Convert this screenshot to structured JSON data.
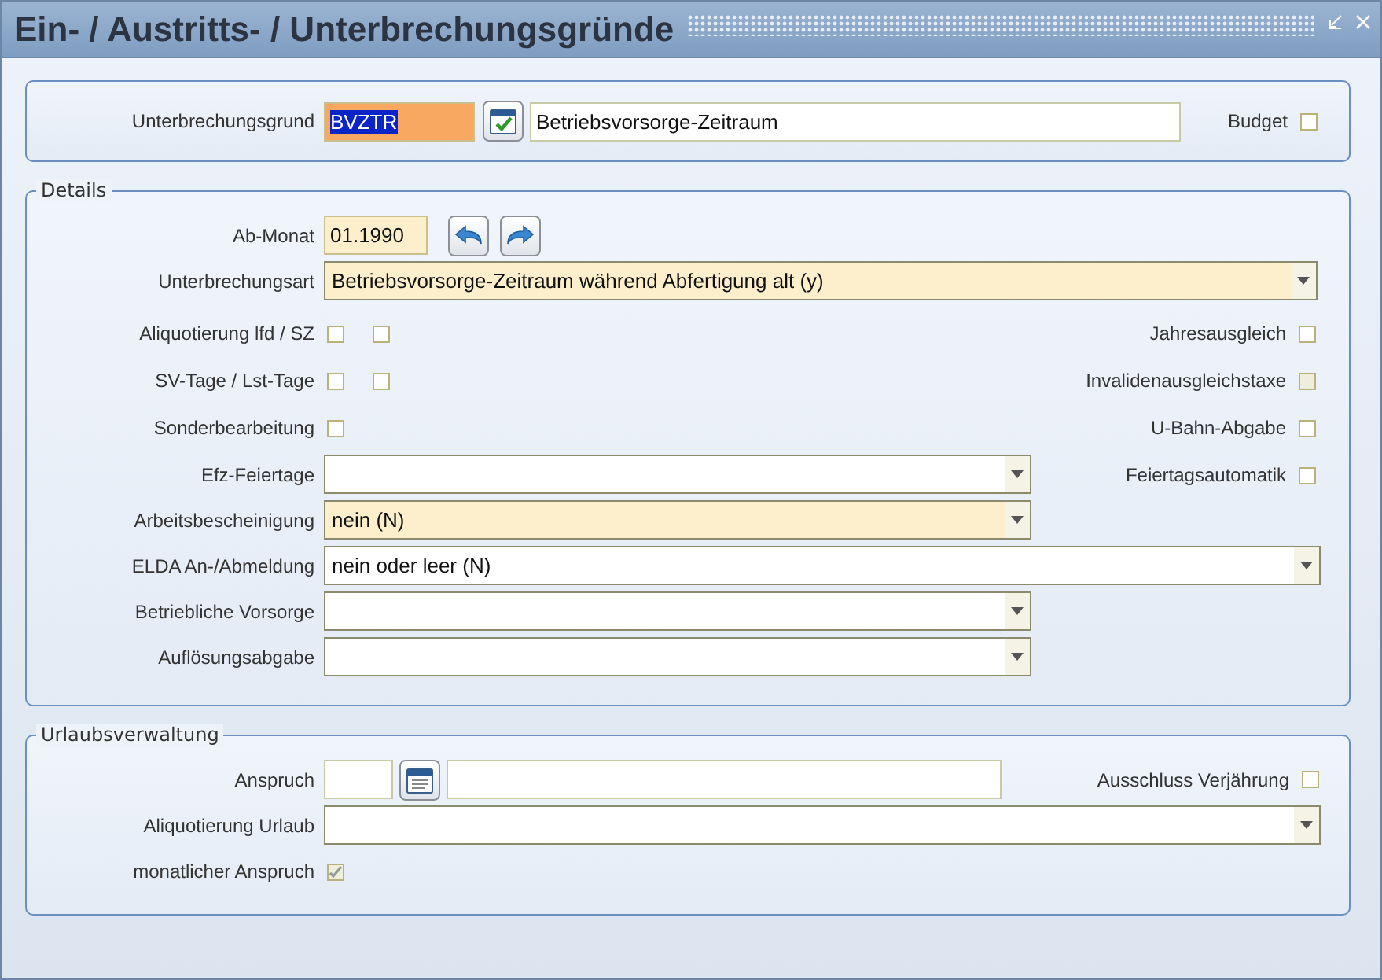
{
  "window": {
    "title": "Ein- / Austritts- / Unterbrechungsgründe"
  },
  "header": {
    "label": "Unterbrechungsgrund",
    "code": "BVZTR",
    "code_selected": true,
    "description": "Betriebsvorsorge-Zeitraum",
    "budget": {
      "label": "Budget",
      "checked": false
    }
  },
  "details": {
    "title": "Details",
    "ab_monat": {
      "label": "Ab-Monat",
      "value": "01.1990",
      "highlighted": true
    },
    "unterbrechungsart": {
      "label": "Unterbrechungsart",
      "value": "Betriebsvorsorge-Zeitraum während Abfertigung alt (y)",
      "highlighted": true
    },
    "left_checks": [
      {
        "label": "Aliquotierung lfd / SZ",
        "boxes": [
          {
            "checked": false
          },
          {
            "checked": false
          }
        ]
      },
      {
        "label": "SV-Tage / Lst-Tage",
        "boxes": [
          {
            "checked": false
          },
          {
            "checked": false
          }
        ]
      },
      {
        "label": "Sonderbearbeitung",
        "boxes": [
          {
            "checked": false
          }
        ]
      }
    ],
    "right_checks": [
      {
        "label": "Jahresausgleich",
        "checked": false,
        "disabled": false
      },
      {
        "label": "Invalidenausgleichstaxe",
        "checked": false,
        "disabled": true
      },
      {
        "label": "U-Bahn-Abgabe",
        "checked": false,
        "disabled": false
      },
      {
        "label": "Feiertagsautomatik",
        "checked": false,
        "disabled": false
      }
    ],
    "dropdowns": [
      {
        "label": "Efz-Feiertage",
        "highlighted": false,
        "wide": false
      },
      {
        "label": "Arbeitsbescheinigung",
        "value": "nein (N)",
        "highlighted": true,
        "wide": false
      },
      {
        "label": "ELDA An-/Abmeldung",
        "value": "nein oder leer (N)",
        "highlighted": false,
        "wide": true
      },
      {
        "label": "Betriebliche Vorsorge",
        "highlighted": false,
        "wide": false
      },
      {
        "label": "Auflösungsabgabe",
        "highlighted": false,
        "wide": false
      }
    ]
  },
  "urlaub": {
    "title": "Urlaubsverwaltung",
    "anspruch": {
      "label": "Anspruch"
    },
    "ausschluss": {
      "label": "Ausschluss Verjährung",
      "checked": false,
      "disabled": false
    },
    "aliquotierung": {
      "label": "Aliquotierung Urlaub"
    },
    "monatlich": {
      "label": "monatlicher Anspruch",
      "checked": true,
      "disabled": true
    }
  }
}
